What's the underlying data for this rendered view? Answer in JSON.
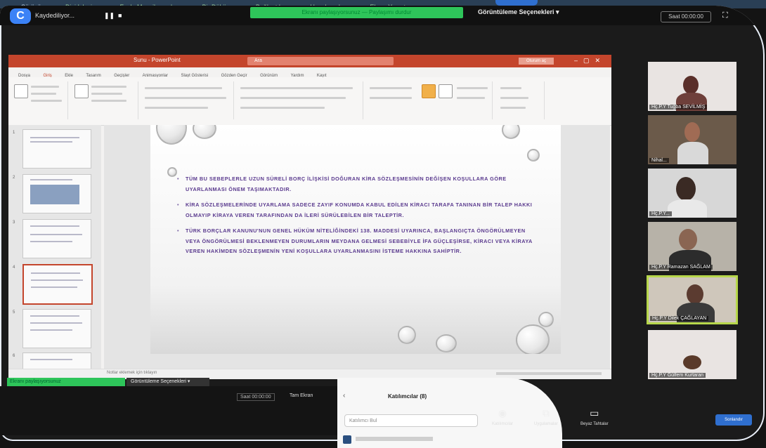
{
  "desktop": {
    "top_items": [
      "Sürücü",
      "Dizi Izleyin",
      "Fazla Mesajlaşmalar",
      "Bir Döküm",
      "Bağlantılar",
      "Uygulamalar",
      "Ekran Yansıt"
    ]
  },
  "zoom": {
    "app_icon": "C",
    "recording_label": "Kaydediliyor...",
    "share_banner": "Ekranı paylaşıyorsunuz — Paylaşımı durdur",
    "view_options": "Görüntüleme Seçenekleri ▾",
    "clock": "Saat 00:00:00",
    "exit_icon": "exit-fullscreen-icon"
  },
  "ppt": {
    "filename": "Sunu - PowerPoint",
    "search_placeholder": "Ara",
    "signin": "Oturum aç",
    "menu": [
      "Dosya",
      "Giriş",
      "Ekle",
      "Tasarım",
      "Geçişler",
      "Animasyonlar",
      "Slayt Gösterisi",
      "Gözden Geçir",
      "Görünüm",
      "Yardım",
      "Kayıt"
    ],
    "menu_active_index": 1,
    "notes_label": "Notlar eklemek için tıklayın",
    "slide_bullets": [
      "TÜM BU SEBEPLERLE UZUN SÜRELİ BORÇ İLİŞKİSİ DOĞURAN KİRA SÖZLEŞMESİNİN DEĞİŞEN KOŞULLARA GÖRE UYARLANMASI ÖNEM TAŞIMAKTADIR.",
      "KİRA SÖZLEŞMELERİNDE UYARLAMA SADECE ZAYIF KONUMDA KABUL EDİLEN KİRACI TARAFA TANINAN BİR TALEP HAKKI OLMAYIP KİRAYA VEREN TARAFINDAN DA İLERİ SÜRÜLEBİLEN BİR TALEPTİR.",
      "TÜRK BORÇLAR KANUNU'NUN GENEL HÜKÜM NİTELİĞİNDEKİ 138. MADDESİ UYARINCA, BAŞLANGIÇTA ÖNGÖRÜLMEYEN VEYA ÖNGÖRÜLMESİ BEKLENMEYEN DURUMLARIN MEYDANA GELMESİ SEBEBİYLE İFA GÜÇLEŞİRSE, KİRACI VEYA KİRAYA VEREN HAKİMDEN SÖZLEŞMENİN YENİ KOŞULLARA UYARLANMASINI İSTEME HAKKINA SAHİPTİR."
    ],
    "thumb_numbers": [
      "1",
      "2",
      "3",
      "4",
      "5",
      "6"
    ]
  },
  "participants": [
    {
      "name": "Hç.P.Y Tuğba SEVİLMİŞ"
    },
    {
      "name": "Nihal..."
    },
    {
      "name": "Hç.P.Y..."
    },
    {
      "name": "Hç.P.Y Ramazan SAĞLAM"
    },
    {
      "name": "Hç.P.Y Dilek ÇAĞLAYAN"
    },
    {
      "name": "Hç.P.Y Gülfem Kurtaran"
    }
  ],
  "bottom": {
    "green_strip": "Ekranı paylaşıyorsunuz",
    "view_strip": "Görüntüleme Seçenekleri ▾",
    "lower_clock": "Saat 00:00:00",
    "lower_exit": "Tam Ekran",
    "panel_title": "Katılımcılar (8)",
    "panel_search": "Katılımcı Bul",
    "toolbar": [
      {
        "icon": "share-screen-icon",
        "label": "Katılımcılar"
      },
      {
        "icon": "apps-icon",
        "label": "Uygulamalar"
      },
      {
        "icon": "whiteboard-icon",
        "label": "Beyaz Tahtalar"
      }
    ],
    "end_label": "Sonlandır"
  }
}
